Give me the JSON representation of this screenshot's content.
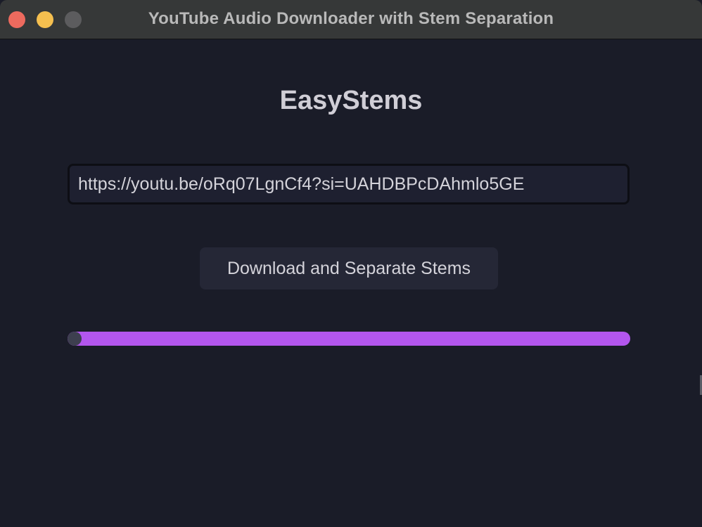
{
  "window": {
    "title": "YouTube Audio Downloader with Stem Separation"
  },
  "app": {
    "heading": "EasyStems",
    "url_input": {
      "value": "https://youtu.be/oRq07LgnCf4?si=UAHDBPcDAhmlo5GE",
      "placeholder": ""
    },
    "action_button_label": "Download and Separate Stems",
    "progress": {
      "value": 0.02
    }
  },
  "colors": {
    "background": "#1a1c28",
    "titlebar": "#363838",
    "progress_accent": "#b356ee",
    "traffic_close": "#ed6a5e",
    "traffic_minimize": "#f5bf4f",
    "traffic_zoom_inactive": "#5c5c5e"
  },
  "icons": {
    "close": "close-circle",
    "minimize": "minimize-circle",
    "zoom": "zoom-circle"
  }
}
